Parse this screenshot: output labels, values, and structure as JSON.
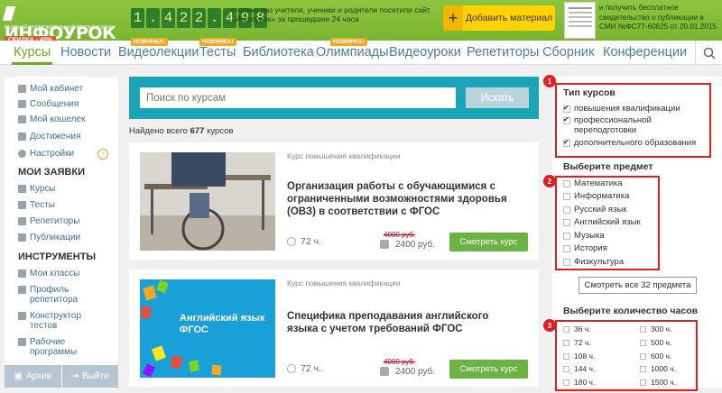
{
  "header": {
    "logo": "ИНФОУРОК",
    "logo_sub": "ВЕДУЩИЙ ОБРАЗОВАТЕЛЬНЫЙ ПОРТАЛ РОССИИ",
    "sale_badge": "СКИДКА - 48%",
    "counter_digits": [
      "1",
      ".",
      "4",
      "2",
      "2",
      ".",
      "4",
      "9",
      "8"
    ],
    "counter_text": "столько раз учителя, ученики и родители посетили сайт «Инфоурок» за прошедшие 24 часа",
    "add_material_plus": "+",
    "add_material_label": "Добавить материал",
    "certificate_text": "и получить бесплатное свидетельство о публикации в СМИ №ФС77-60625 от 20.01.2015"
  },
  "nav": {
    "items": [
      {
        "label": "Курсы",
        "badge": ""
      },
      {
        "label": "Новости",
        "badge": ""
      },
      {
        "label": "Видеолекции",
        "badge": "НОВИНКА!"
      },
      {
        "label": "Тесты",
        "badge": "НОВИНКА!"
      },
      {
        "label": "Библиотека",
        "badge": ""
      },
      {
        "label": "Олимпиады",
        "badge": "НОВИНКА!"
      },
      {
        "label": "Видеоуроки",
        "badge": ""
      },
      {
        "label": "Репетиторы",
        "badge": ""
      },
      {
        "label": "Сборник",
        "badge": ""
      },
      {
        "label": "Конференции",
        "badge": ""
      }
    ],
    "active_index": 0,
    "search_icon": "magnifier-icon"
  },
  "sidebar": {
    "top_items": [
      "Мой кабинет",
      "Сообщения",
      "Мой кошелек",
      "Достижения",
      "Настройки"
    ],
    "settings_notification": "!",
    "section_requests": "МОИ ЗАЯВКИ",
    "request_items": [
      "Курсы",
      "Тесты",
      "Репетиторы",
      "Публикации"
    ],
    "section_tools": "ИНСТРУМЕНТЫ",
    "tool_items": [
      "Мои классы",
      "Профиль репетитора",
      "Конструктор тестов",
      "Рабочие программы"
    ],
    "archive_label": "Архив",
    "logout_label": "Выйти"
  },
  "search": {
    "placeholder": "Поиск по курсам",
    "button_label": "Искать"
  },
  "found": {
    "prefix": "Найдено всего",
    "count": "677",
    "suffix": "курсов"
  },
  "courses": [
    {
      "type": "Курс повышения квалификации",
      "title": "Организация работы с обучающимися с ограниченными возможностями здоровья (ОВЗ) в соответствии с ФГОС",
      "hours": "72 ч.",
      "price_old": "4000 руб.",
      "price_new": "2400 руб.",
      "button": "Смотреть курс"
    },
    {
      "type": "Курс повышения квалификации",
      "title": "Специфика преподавания английского языка с учетом требований ФГОС",
      "hours": "72 ч.",
      "price_old": "4000 руб.",
      "price_new": "2400 руб.",
      "button": "Смотреть курс",
      "image_text": "Английский язык ФГОС"
    }
  ],
  "filters": {
    "course_type": {
      "badge": "1",
      "title": "Тип курсов",
      "options": [
        {
          "label": "повышения квалификации",
          "checked": true
        },
        {
          "label": "профессиональной переподготовки",
          "checked": true
        },
        {
          "label": "дополнительного образования",
          "checked": true
        }
      ]
    },
    "subject": {
      "badge": "2",
      "title": "Выберите предмет",
      "options": [
        "Математика",
        "Информатика",
        "Русский язык",
        "Английский язык",
        "Музыка",
        "История",
        "Физкультура"
      ],
      "see_all": "Смотреть все 32 предмета"
    },
    "hours": {
      "badge": "3",
      "title": "Выберите количество часов",
      "left": [
        "36 ч.",
        "72 ч.",
        "108 ч.",
        "144 ч.",
        "180 ч."
      ],
      "right": [
        "300 ч.",
        "500 ч.",
        "600 ч.",
        "1000 ч.",
        "1500 ч."
      ]
    }
  }
}
